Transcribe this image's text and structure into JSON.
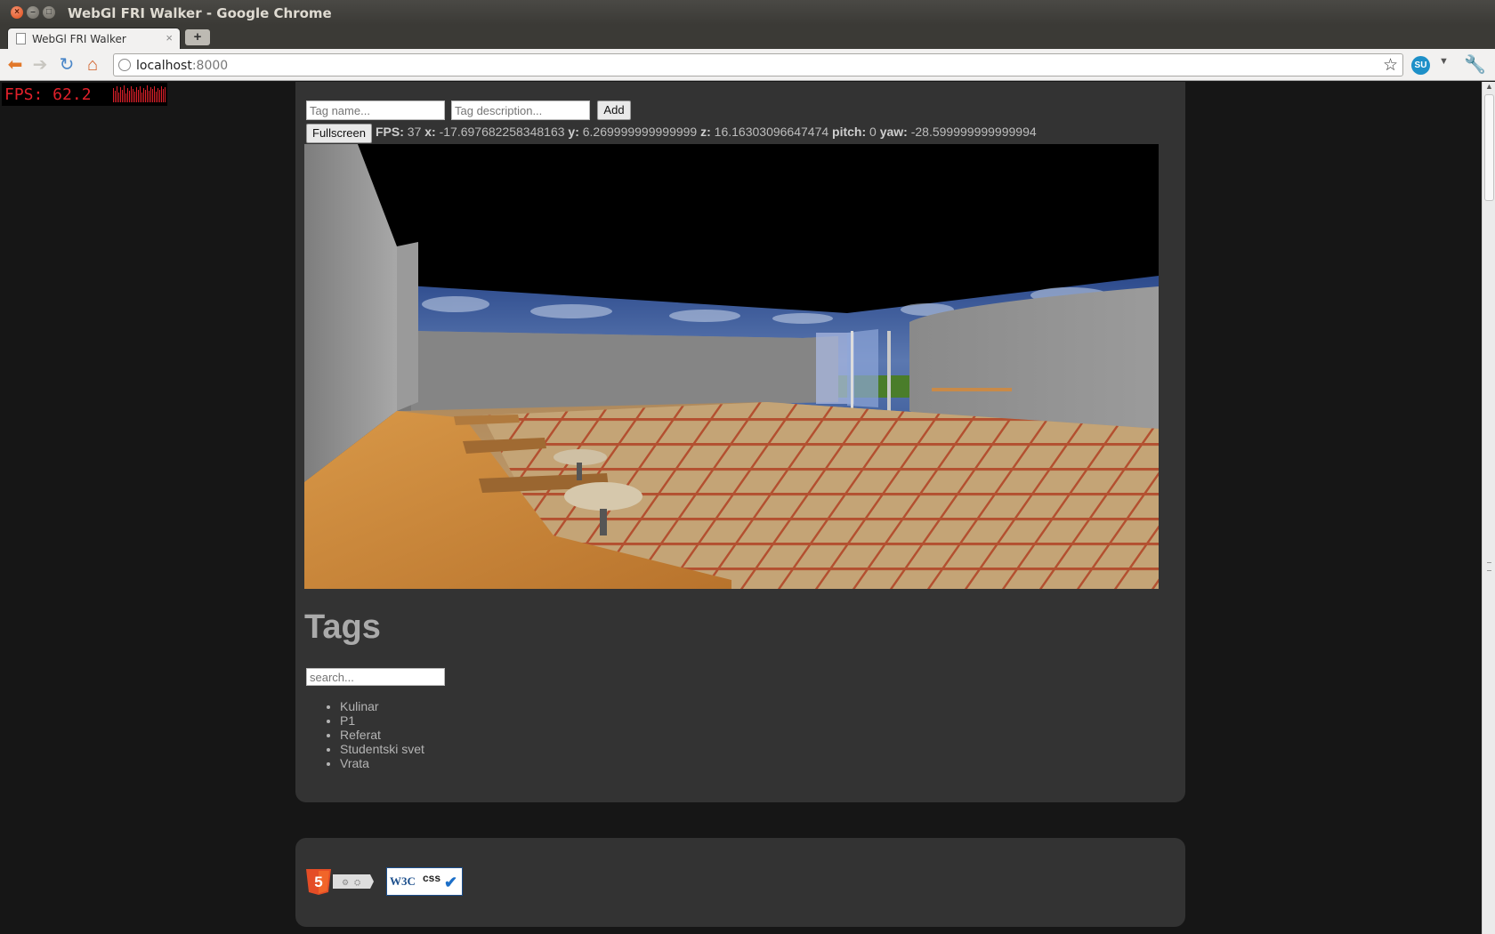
{
  "window": {
    "title": "WebGl FRI Walker - Google Chrome"
  },
  "tab": {
    "title": "WebGl FRI Walker",
    "close_glyph": "×",
    "new_tab_glyph": "+"
  },
  "toolbar": {
    "url_host": "localhost",
    "url_port": ":8000",
    "stumbleupon_label": "SU"
  },
  "fps_overlay": {
    "text": "FPS:  62.2"
  },
  "tag_form": {
    "name_placeholder": "Tag name...",
    "description_placeholder": "Tag description...",
    "add_label": "Add",
    "fullscreen_label": "Fullscreen"
  },
  "stats": {
    "fps_label": "FPS:",
    "fps_value": "37",
    "x_label": "x:",
    "x_value": "-17.697682258348163",
    "y_label": "y:",
    "y_value": "6.269999999999999",
    "z_label": "z:",
    "z_value": "16.16303096647474",
    "pitch_label": "pitch:",
    "pitch_value": "0",
    "yaw_label": "yaw:",
    "yaw_value": "-28.599999999999994"
  },
  "tags_section": {
    "heading": "Tags",
    "search_placeholder": "search...",
    "items": [
      "Kulinar",
      "P1",
      "Referat",
      "Studentski svet",
      "Vrata"
    ]
  },
  "footer": {
    "html5_digit": "5",
    "w3c_label": "W3C",
    "css_label": "css"
  },
  "colors": {
    "page_bg": "#161616",
    "panel_bg": "#333333",
    "fps_red": "#e0202a"
  }
}
